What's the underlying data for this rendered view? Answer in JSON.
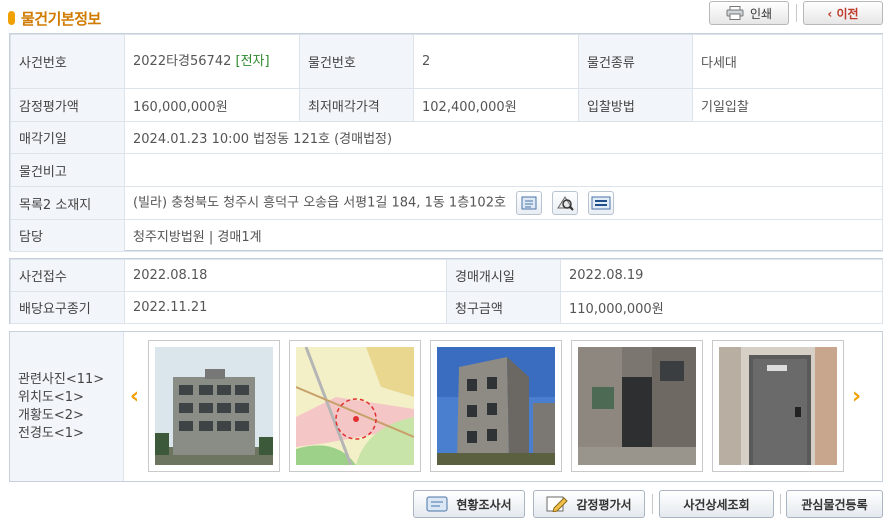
{
  "header": {
    "title": "물건기본정보"
  },
  "toolbar": {
    "print_label": "인쇄",
    "prev_label": "‹ 이전"
  },
  "info": {
    "case_no_label": "사건번호",
    "case_no_value": "2022타경56742",
    "case_no_tag": "[전자]",
    "item_no_label": "물건번호",
    "item_no_value": "2",
    "item_type_label": "물건종류",
    "item_type_value": "다세대",
    "appraisal_label": "감정평가액",
    "appraisal_value": "160,000,000원",
    "min_price_label": "최저매각가격",
    "min_price_value": "102,400,000원",
    "bid_method_label": "입찰방법",
    "bid_method_value": "기일입찰",
    "sale_date_label": "매각기일",
    "sale_date_value": "2024.01.23 10:00 법정동 121호 (경매법정)",
    "remark_label": "물건비고",
    "remark_value": "",
    "address_label": "목록2 소재지",
    "address_value": "(빌라) 충청북도 청주시 흥덕구 오송읍 서평1길 184, 1동 1층102호",
    "charge_label": "담당",
    "charge_value": "청주지방법원 | 경매1계"
  },
  "dates": {
    "received_label": "사건접수",
    "received_value": "2022.08.18",
    "auction_start_label": "경매개시일",
    "auction_start_value": "2022.08.19",
    "dividend_label": "배당요구종기",
    "dividend_value": "2022.11.21",
    "claim_label": "청구금액",
    "claim_value": "110,000,000원"
  },
  "gallery": {
    "lines": [
      "관련사진<11>",
      "위치도<1>",
      "개황도<2>",
      "전경도<1>"
    ],
    "prev_arrow": "‹",
    "next_arrow": "›"
  },
  "actions": {
    "survey_label": "현황조사서",
    "appraisal_doc_label": "감정평가서",
    "case_detail_label": "사건상세조회",
    "watch_label": "관심물건등록"
  },
  "colors": {
    "accent": "#f0a000",
    "title": "#d07a00",
    "tag": "#2c8a2c"
  }
}
